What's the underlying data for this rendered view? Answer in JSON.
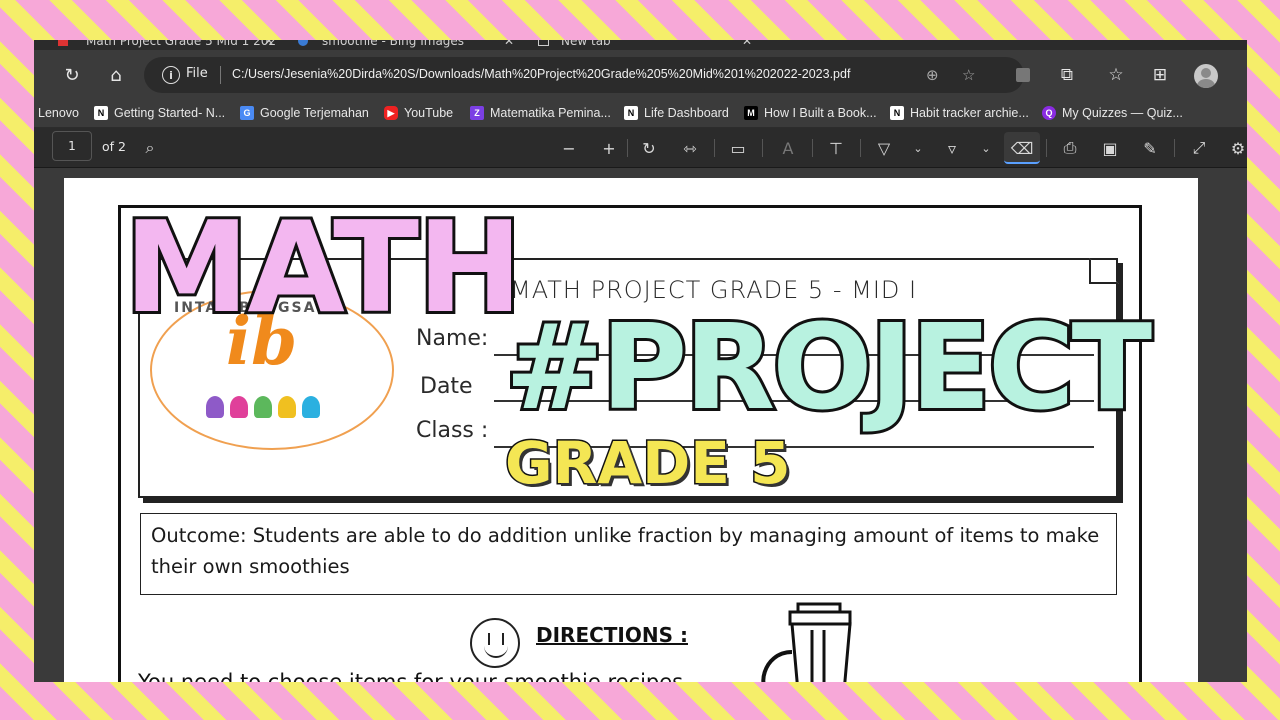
{
  "tabs": [
    {
      "label": "Math Project Grade 5 Mid 1 202",
      "close": "✕"
    },
    {
      "label": "smoothie - Bing Images",
      "close": "✕"
    },
    {
      "label": "New tab",
      "close": "✕"
    }
  ],
  "address_bar": {
    "file_label": "File",
    "url": "C:/Users/Jesenia%20Dirda%20S/Downloads/Math%20Project%20Grade%205%20Mid%201%202022-2023.pdf"
  },
  "bookmarks": [
    {
      "label": "Lenovo",
      "icon": "none"
    },
    {
      "label": "Getting Started- N...",
      "icon": "notion-icon"
    },
    {
      "label": "Google Terjemahan",
      "icon": "translate-icon"
    },
    {
      "label": "YouTube",
      "icon": "youtube-icon"
    },
    {
      "label": "Matematika Pemina...",
      "icon": "z-icon"
    },
    {
      "label": "Life Dashboard",
      "icon": "notion-icon"
    },
    {
      "label": "How I Built a Book...",
      "icon": "medium-icon"
    },
    {
      "label": "Habit tracker archie...",
      "icon": "notion-icon"
    },
    {
      "label": "My Quizzes — Quiz...",
      "icon": "quizizz-icon"
    }
  ],
  "pdf_toolbar": {
    "page_number": "1",
    "page_count": "of 2"
  },
  "document": {
    "title": "MATH PROJECT GRADE 5 - MID I",
    "name_label": "Name:",
    "date_label": "Date",
    "class_label": "Class :",
    "logo_text": "INTAN BANGSA",
    "logo_mark": "ib",
    "outcome": "Outcome: Students are able to do addition unlike fraction by managing amount of items to make their own smoothies",
    "directions_heading": "DIRECTIONS :",
    "directions_body": "You need to choose items for your smoothie recipes"
  },
  "overlay": {
    "line1": "MATH",
    "line2": "#PROJECT",
    "line3": "GRADE 5"
  },
  "colors": {
    "stripe_pink": "#f7a8d8",
    "stripe_yellow": "#f5ee6a",
    "math_fill": "#f3b7f0",
    "project_fill": "#b8f2e0",
    "grade_fill": "#f4e654",
    "logo_orange": "#f08a1c"
  }
}
